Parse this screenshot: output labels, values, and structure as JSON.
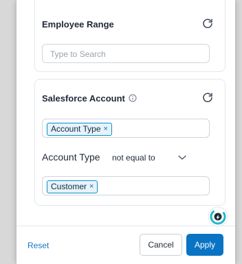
{
  "employee_range": {
    "title": "Employee Range",
    "search_placeholder": "Type to Search",
    "refresh_icon": "refresh-icon"
  },
  "salesforce_account": {
    "title": "Salesforce Account",
    "info_icon": "info-icon",
    "refresh_icon": "refresh-icon",
    "field_chip": {
      "label": "Account Type",
      "remove": "×"
    },
    "condition": {
      "field": "Account Type",
      "operator": "not equal to"
    },
    "value_chip": {
      "label": "Customer",
      "remove": "×"
    }
  },
  "footer": {
    "reset_label": "Reset",
    "cancel_label": "Cancel",
    "apply_label": "Apply"
  },
  "colors": {
    "accent": "#0a74c4",
    "chip_bg": "#e6f3fb",
    "chip_border": "#0b8ec7",
    "brand": "#1fb5c9"
  }
}
